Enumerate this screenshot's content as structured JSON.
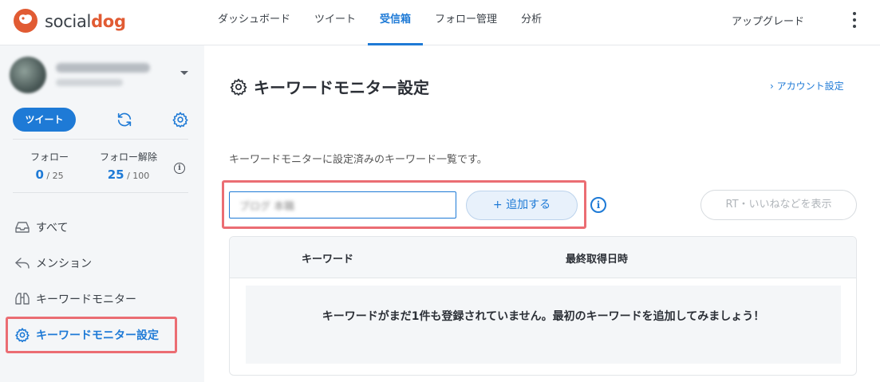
{
  "brand": {
    "name_prefix": "social",
    "name_suffix": "dog"
  },
  "nav": {
    "items": [
      {
        "label": "ダッシュボード",
        "active": false
      },
      {
        "label": "ツイート",
        "active": false
      },
      {
        "label": "受信箱",
        "active": true
      },
      {
        "label": "フォロー管理",
        "active": false
      },
      {
        "label": "分析",
        "active": false
      }
    ],
    "upgrade": "アップグレード"
  },
  "sidebar": {
    "tweet_button": "ツイート",
    "stats": {
      "follow": {
        "label": "フォロー",
        "value": "0",
        "limit": "/ 25"
      },
      "unfollow": {
        "label": "フォロー解除",
        "value": "25",
        "limit": "/ 100"
      }
    },
    "items": [
      {
        "label": "すべて",
        "icon": "inbox-icon",
        "active": false
      },
      {
        "label": "メンション",
        "icon": "reply-icon",
        "active": false
      },
      {
        "label": "キーワードモニター",
        "icon": "binoculars-icon",
        "active": false
      },
      {
        "label": "キーワードモニター設定",
        "icon": "gear-icon",
        "active": true
      }
    ]
  },
  "main": {
    "title": "キーワードモニター設定",
    "account_link": "› アカウント設定",
    "description": "キーワードモニターに設定済みのキーワード一覧です。",
    "input_value": "ブログ 本職",
    "add_button": "+ 追加する",
    "rt_button": "RT・いいねなどを表示",
    "table": {
      "headers": [
        "キーワード",
        "最終取得日時"
      ],
      "empty_message": "キーワードがまだ1件も登録されていません。最初のキーワードを追加してみましょう！"
    }
  },
  "colors": {
    "accent": "#1e7ad6",
    "brand": "#e15b33",
    "highlight": "#eb6d73"
  }
}
